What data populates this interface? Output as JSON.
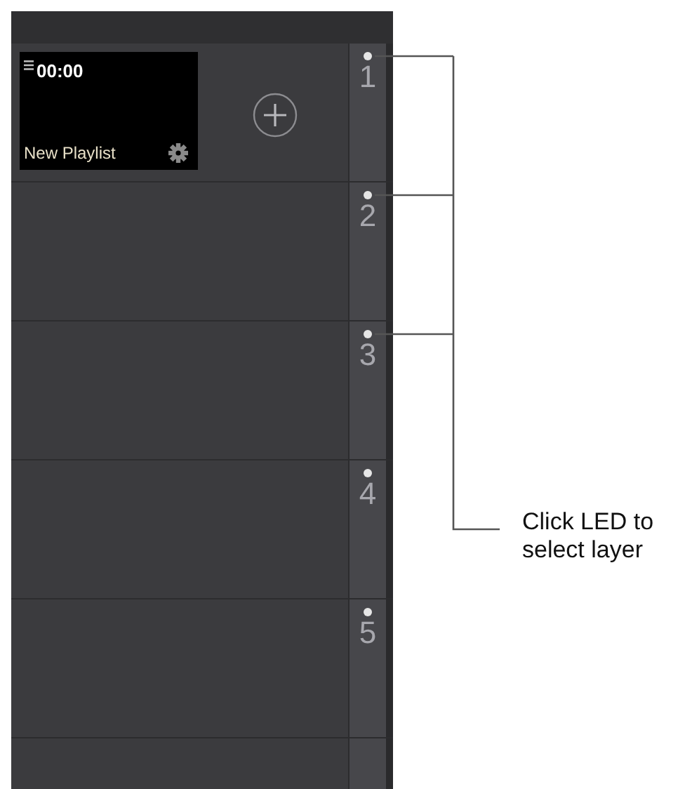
{
  "playlist": {
    "time": "00:00",
    "title": "New Playlist"
  },
  "layers": [
    {
      "number": "1",
      "leader": true
    },
    {
      "number": "2",
      "leader": true
    },
    {
      "number": "3",
      "leader": true
    },
    {
      "number": "4",
      "leader": false
    },
    {
      "number": "5",
      "leader": false
    }
  ],
  "callout": {
    "text": "Click LED to select layer"
  }
}
